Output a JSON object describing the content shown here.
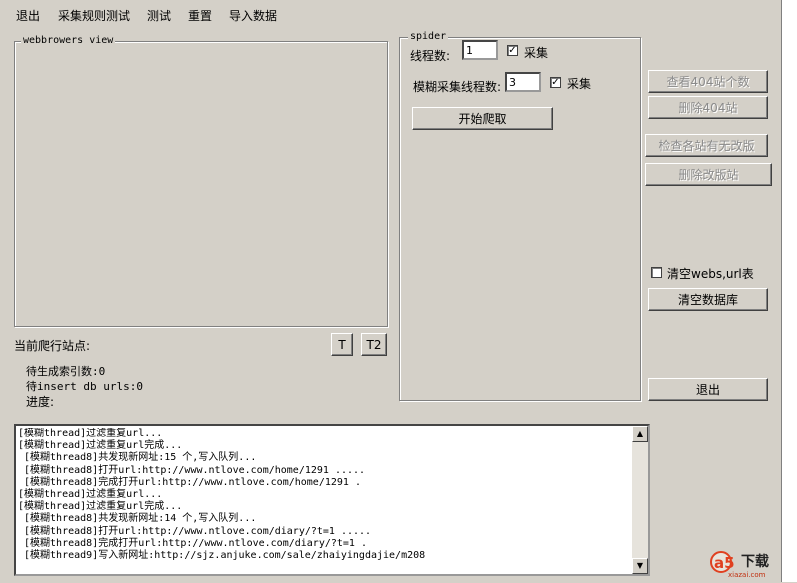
{
  "menu": {
    "items": [
      "退出",
      "采集规则测试",
      "测试",
      "重置",
      "导入数据"
    ]
  },
  "webview": {
    "title": "webbrowers view"
  },
  "status": {
    "current_site_label": "当前爬行站点:",
    "t_button": "T",
    "t2_button": "T2",
    "pending_index": "待生成索引数:0",
    "pending_insert": "待insert db urls:0",
    "progress": "进度:"
  },
  "spider": {
    "title": "spider",
    "threads_label": "线程数:",
    "threads_value": "1",
    "collect_label_1": "采集",
    "collect_checked_1": true,
    "fuzzy_threads_label": "模糊采集线程数:",
    "fuzzy_threads_value": "3",
    "collect_label_2": "采集",
    "collect_checked_2": true,
    "start_button": "开始爬取"
  },
  "right_panel": {
    "view_404": "查看404站个数",
    "delete_404": "删除404站",
    "check_no_revision": "检查各站有无改版",
    "delete_revised": "删除改版站",
    "clear_webs_label": "清空webs,url表",
    "clear_webs_checked": false,
    "clear_db": "清空数据库",
    "exit": "退出"
  },
  "log": {
    "lines": [
      "[模糊thread]过滤重复url...",
      "[模糊thread]过滤重复url完成...",
      " [模糊thread8]共发现新网址:15 个,写入队列...",
      " [模糊thread8]打开url:http://www.ntlove.com/home/1291 .....",
      " [模糊thread8]完成打开url:http://www.ntlove.com/home/1291 .",
      "[模糊thread]过滤重复url...",
      "[模糊thread]过滤重复url完成...",
      " [模糊thread8]共发现新网址:14 个,写入队列...",
      " [模糊thread8]打开url:http://www.ntlove.com/diary/?t=1 .....",
      " [模糊thread8]完成打开url:http://www.ntlove.com/diary/?t=1 .",
      " [模糊thread9]写入新网址:http://sjz.anjuke.com/sale/zhaiyingdajie/m208"
    ]
  },
  "watermark": {
    "brand": "a5",
    "title": "下载",
    "url": "xiazai.com"
  }
}
